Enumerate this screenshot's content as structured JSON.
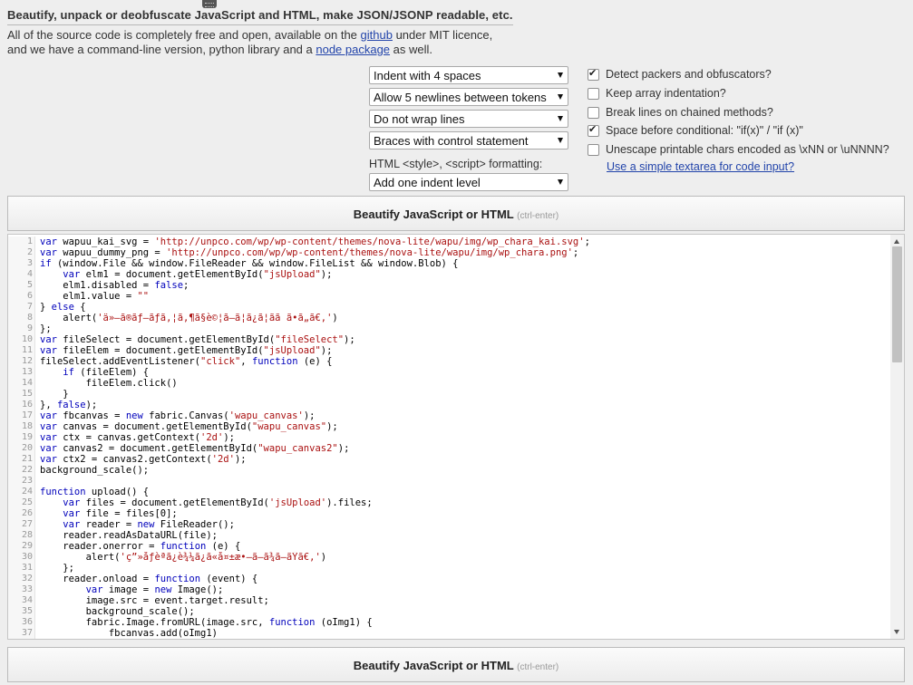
{
  "header": {
    "title": "Beautify, unpack or deobfuscate JavaScript and HTML, make JSON/JSONP readable, etc.",
    "intro_line1_a": "All of the source code is completely free and open, available on the ",
    "github_link": "github",
    "intro_line1_b": " under MIT licence,",
    "intro_line2_a": "and we have a command-line version, python library and a ",
    "node_link": "node package",
    "intro_line2_b": " as well."
  },
  "selects": {
    "indent": "Indent with 4 spaces",
    "newlines": "Allow 5 newlines between tokens",
    "wrap": "Do not wrap lines",
    "braces": "Braces with control statement",
    "html_label": "HTML <style>, <script> formatting:",
    "html_format": "Add one indent level"
  },
  "options": [
    {
      "label": "Detect packers and obfuscators?",
      "checked": true
    },
    {
      "label": "Keep array indentation?",
      "checked": false
    },
    {
      "label": "Break lines on chained methods?",
      "checked": false
    },
    {
      "label": "Space before conditional: \"if(x)\" / \"if (x)\"",
      "checked": true
    },
    {
      "label": "Unescape printable chars encoded as \\xNN or \\uNNNN?",
      "checked": false
    }
  ],
  "textarea_link": "Use a simple textarea for code input?",
  "button": {
    "label": "Beautify JavaScript or HTML",
    "hint": "(ctrl-enter)"
  },
  "editor": {
    "lines": [
      "var wapuu_kai_svg = 'http://unpco.com/wp/wp-content/themes/nova-lite/wapu/img/wp_chara_kai.svg';",
      "var wapuu_dummy_png = 'http://unpco.com/wp/wp-content/themes/nova-lite/wapu/img/wp_chara.png';",
      "if (window.File && window.FileReader && window.FileList && window.Blob) {",
      "    var elm1 = document.getElementById(\"jsUpload\");",
      "    elm1.disabled = false;",
      "    elm1.value = \"\"",
      "} else {",
      "    alert('ä»–ã®ãƒ–ãƒã‚¦ã‚¶ã§è©¦ã—ã¦ã¿ã¦ãã ã•ã„ã€‚')",
      "};",
      "var fileSelect = document.getElementById(\"fileSelect\");",
      "var fileElem = document.getElementById(\"jsUpload\");",
      "fileSelect.addEventListener(\"click\", function (e) {",
      "    if (fileElem) {",
      "        fileElem.click()",
      "    }",
      "}, false);",
      "var fbcanvas = new fabric.Canvas('wapu_canvas');",
      "var canvas = document.getElementById(\"wapu_canvas\");",
      "var ctx = canvas.getContext('2d');",
      "var canvas2 = document.getElementById(\"wapu_canvas2\");",
      "var ctx2 = canvas2.getContext('2d');",
      "background_scale();",
      "",
      "function upload() {",
      "    var files = document.getElementById('jsUpload').files;",
      "    var file = files[0];",
      "    var reader = new FileReader();",
      "    reader.readAsDataURL(file);",
      "    reader.onerror = function (e) {",
      "        alert('ç”»åƒèª­ã¿è¾¼ã¿ã«å¤±æ•—ã—ã¾ã—ãŸã€‚')",
      "    };",
      "    reader.onload = function (event) {",
      "        var image = new Image();",
      "        image.src = event.target.result;",
      "        background_scale();",
      "        fabric.Image.fromURL(image.src, function (oImg1) {",
      "            fbcanvas.add(oImg1)"
    ]
  }
}
